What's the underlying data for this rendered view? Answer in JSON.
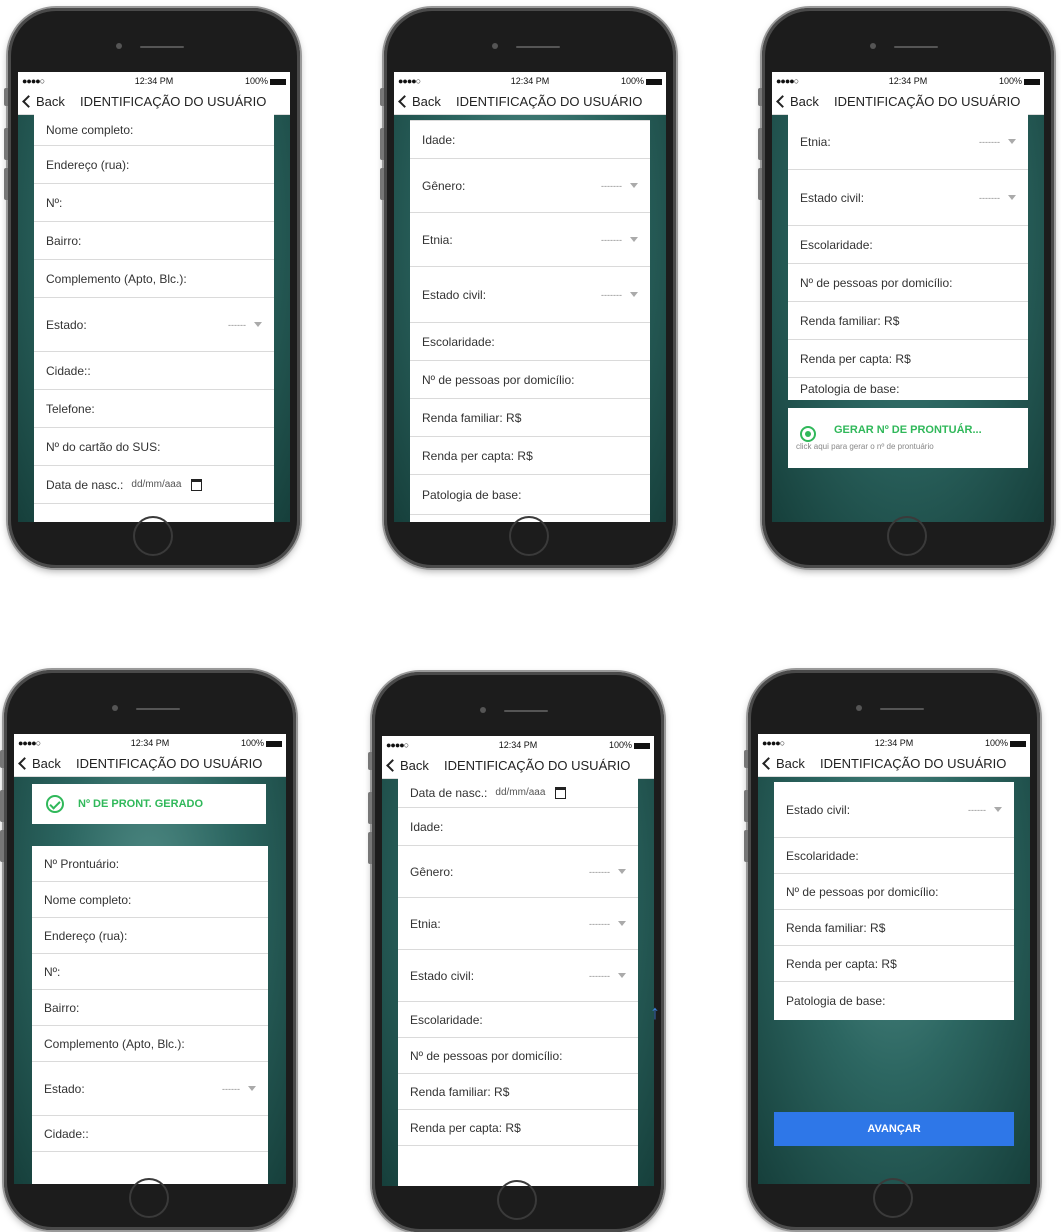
{
  "status": {
    "signal": "●●●●○",
    "time": "12:34 PM",
    "battery": "100%"
  },
  "nav": {
    "back": "Back",
    "title": "IDENTIFICAÇÃO DO USUÁRIO"
  },
  "fields": {
    "nome": "Nome completo:",
    "endereco": "Endereço (rua):",
    "numero": "Nº:",
    "bairro": "Bairro:",
    "complemento": "Complemento (Apto, Blc.):",
    "estado": "Estado:",
    "cidade": "Cidade::",
    "telefone": "Telefone:",
    "sus": "Nº do cartão do SUS:",
    "datanasc": "Data de nasc.:",
    "datanasc_value": "dd/mm/aaa",
    "idade": "Idade:",
    "genero": "Gênero:",
    "etnia": "Etnia:",
    "estado_civil": "Estado civil:",
    "escolaridade": "Escolaridade:",
    "pessoas": "Nº de pessoas por domicílio:",
    "renda_familiar": "Renda familiar: R$",
    "renda_capita": "Renda per capta: R$",
    "patologia": "Patologia de base:",
    "prontuario": "Nº Prontuário:"
  },
  "dropdown_value": "-------",
  "dropdown_value_short": "------",
  "gerar": {
    "label": "GERAR Nº DE PRONTUÁR...",
    "hint": "click aqui para gerar o nº de prontuário"
  },
  "gerado": {
    "label": "Nº DE PRONT. GERADO"
  },
  "avancar": {
    "label": "AVANÇAR"
  },
  "colors": {
    "accent_green": "#30b85a",
    "primary_blue": "#2e77e8",
    "teal_bg": "#2c6661"
  }
}
